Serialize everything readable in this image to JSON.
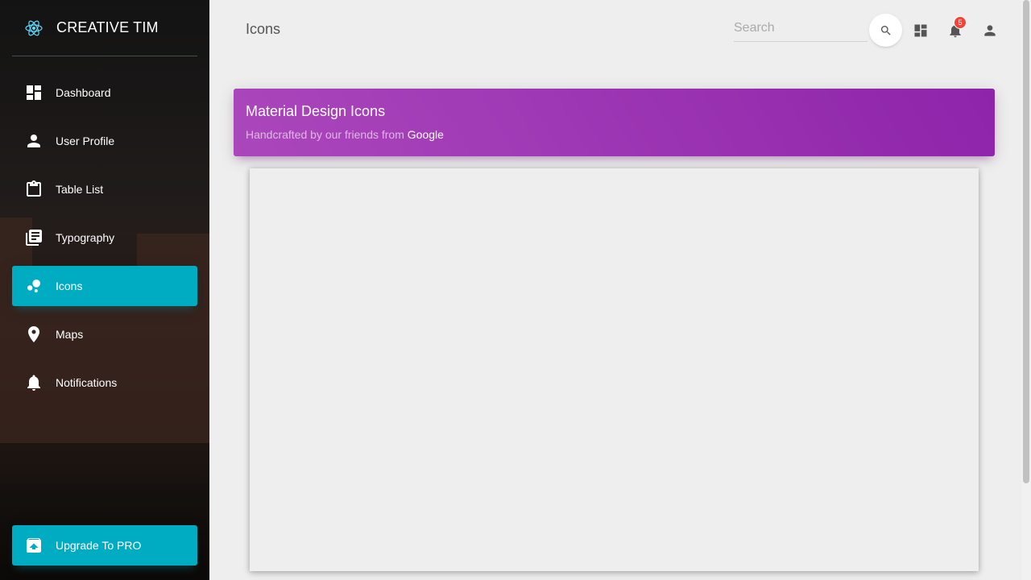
{
  "brand": {
    "name": "CREATIVE TIM",
    "logo_icon": "react-atom-icon"
  },
  "sidebar": {
    "items": [
      {
        "label": "Dashboard",
        "icon": "dashboard-icon",
        "active": false
      },
      {
        "label": "User Profile",
        "icon": "person-icon",
        "active": false
      },
      {
        "label": "Table List",
        "icon": "clipboard-icon",
        "active": false
      },
      {
        "label": "Typography",
        "icon": "library-books-icon",
        "active": false
      },
      {
        "label": "Icons",
        "icon": "bubble-chart-icon",
        "active": true
      },
      {
        "label": "Maps",
        "icon": "location-pin-icon",
        "active": false
      },
      {
        "label": "Notifications",
        "icon": "bell-icon",
        "active": false
      }
    ],
    "upgrade": {
      "label": "Upgrade To PRO",
      "icon": "unarchive-icon"
    }
  },
  "header": {
    "title": "Icons",
    "search": {
      "placeholder": "Search",
      "value": ""
    },
    "notifications_count": "5"
  },
  "card": {
    "title": "Material Design Icons",
    "subtitle": "Handcrafted by our friends from",
    "subtitle_link": "Google"
  },
  "colors": {
    "accent": "#00acc1",
    "card_header_start": "#ab47bc",
    "card_header_end": "#8e24aa",
    "badge": "#f44336"
  }
}
